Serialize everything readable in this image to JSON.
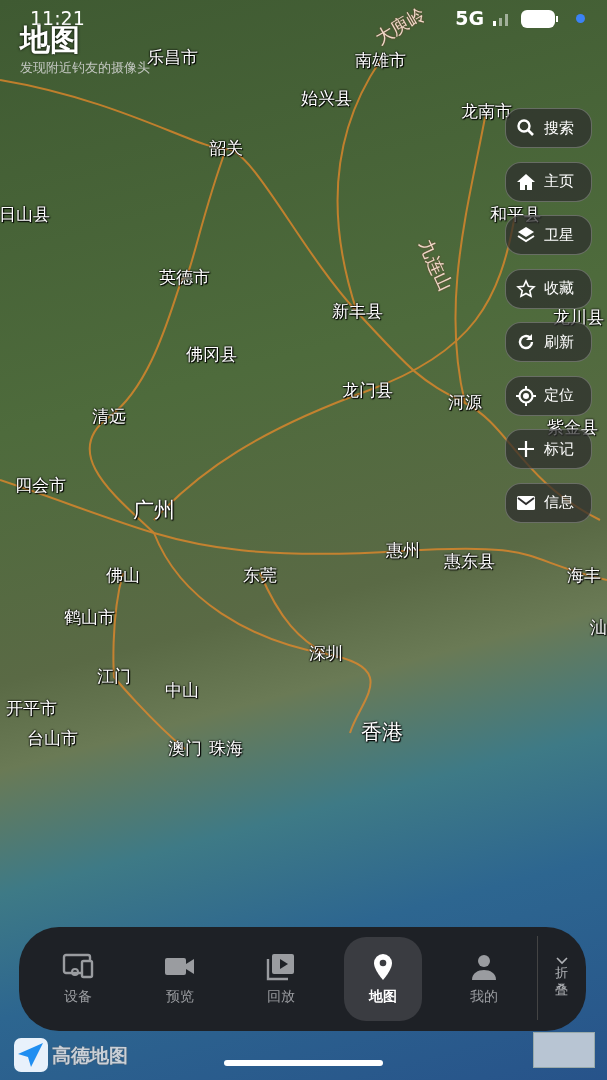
{
  "status_bar": {
    "time": "11:21",
    "network": "5G"
  },
  "header": {
    "title": "地图",
    "subtitle": "发现附近钓友的摄像头"
  },
  "map_labels": [
    {
      "text": "乐昌市"
    },
    {
      "text": "大庾岭"
    },
    {
      "text": "南雄市"
    },
    {
      "text": "始兴县"
    },
    {
      "text": "龙南市"
    },
    {
      "text": "韶关"
    },
    {
      "text": "日山县"
    },
    {
      "text": "和平县"
    },
    {
      "text": "九连山"
    },
    {
      "text": "英德市"
    },
    {
      "text": "龙川县"
    },
    {
      "text": "新丰县"
    },
    {
      "text": "佛冈县"
    },
    {
      "text": "龙门县"
    },
    {
      "text": "河源"
    },
    {
      "text": "紫金县"
    },
    {
      "text": "清远"
    },
    {
      "text": "四会市"
    },
    {
      "text": "广州"
    },
    {
      "text": "惠州"
    },
    {
      "text": "惠东县"
    },
    {
      "text": "佛山"
    },
    {
      "text": "东莞"
    },
    {
      "text": "海丰"
    },
    {
      "text": "鹤山市"
    },
    {
      "text": "汕"
    },
    {
      "text": "深圳"
    },
    {
      "text": "江门"
    },
    {
      "text": "中山"
    },
    {
      "text": "开平市"
    },
    {
      "text": "台山市"
    },
    {
      "text": "香港"
    },
    {
      "text": "澳门"
    },
    {
      "text": "珠海"
    }
  ],
  "side_buttons": [
    {
      "kind": "search",
      "label": "搜索"
    },
    {
      "kind": "home",
      "label": "主页"
    },
    {
      "kind": "layers",
      "label": "卫星"
    },
    {
      "kind": "star",
      "label": "收藏"
    },
    {
      "kind": "refresh",
      "label": "刷新"
    },
    {
      "kind": "locate",
      "label": "定位"
    },
    {
      "kind": "plus",
      "label": "标记"
    },
    {
      "kind": "mail",
      "label": "信息"
    }
  ],
  "bottom_nav": {
    "items": [
      {
        "kind": "devices",
        "label": "设备",
        "selected": false
      },
      {
        "kind": "video",
        "label": "预览",
        "selected": false
      },
      {
        "kind": "playback",
        "label": "回放",
        "selected": false
      },
      {
        "kind": "pin",
        "label": "地图",
        "selected": true
      },
      {
        "kind": "person",
        "label": "我的",
        "selected": false
      }
    ],
    "collapse": "折叠"
  },
  "map_logo": "高德地图"
}
